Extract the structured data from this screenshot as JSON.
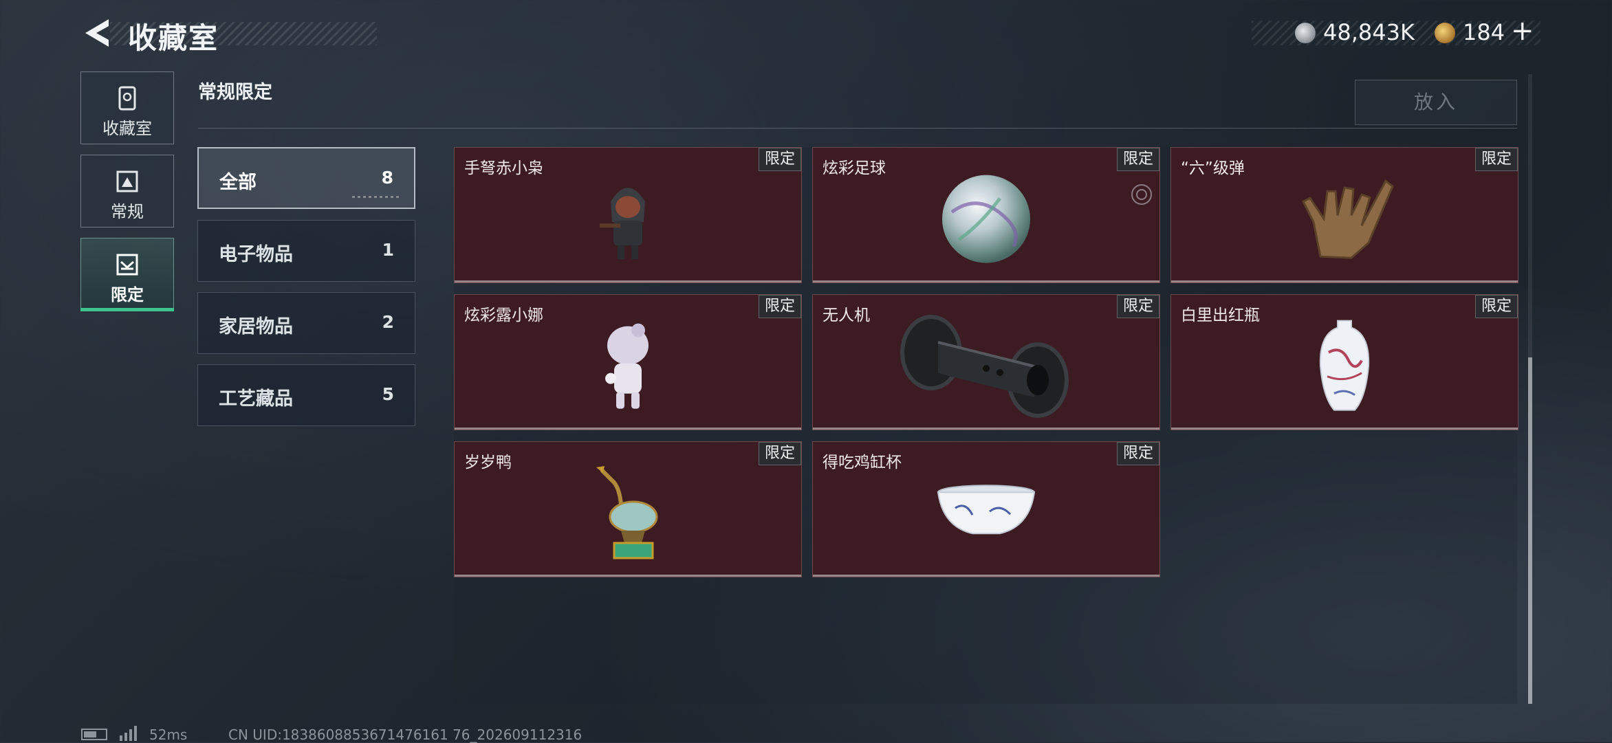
{
  "header": {
    "title": "收藏室",
    "currency_primary": "48,843K",
    "currency_secondary": "184",
    "plus_label": "+"
  },
  "nav": [
    {
      "label": "收藏室",
      "icon": "collection-icon"
    },
    {
      "label": "常规",
      "icon": "regular-icon"
    },
    {
      "label": "限定",
      "icon": "limited-icon",
      "active": true
    }
  ],
  "section": {
    "title": "常规限定",
    "place_button": "放入"
  },
  "categories": [
    {
      "name": "全部",
      "count": "8",
      "active": true
    },
    {
      "name": "电子物品",
      "count": "1"
    },
    {
      "name": "家居物品",
      "count": "2"
    },
    {
      "name": "工艺藏品",
      "count": "5"
    }
  ],
  "items": [
    {
      "name": "手弩赤小枭",
      "tag": "限定",
      "icon": "hooded-figure-icon"
    },
    {
      "name": "炫彩足球",
      "tag": "限定",
      "icon": "iridescent-ball-icon"
    },
    {
      "name": "“六”级弹",
      "tag": "限定",
      "icon": "bronze-hand-icon"
    },
    {
      "name": "炫彩露小娜",
      "tag": "限定",
      "icon": "white-figurine-icon"
    },
    {
      "name": "无人机",
      "tag": "限定",
      "icon": "drone-roller-icon"
    },
    {
      "name": "白里出红瓶",
      "tag": "限定",
      "icon": "porcelain-vase-icon"
    },
    {
      "name": "岁岁鸭",
      "tag": "限定",
      "icon": "enamel-duck-icon"
    },
    {
      "name": "得吃鸡缸杯",
      "tag": "限定",
      "icon": "porcelain-cup-icon"
    }
  ],
  "footer": {
    "ping": "52ms",
    "uid": "CN UID:1838608853671476161 76_202609112316"
  },
  "colors": {
    "accent": "#3ec48e",
    "card_bg": "#3d1b22"
  }
}
